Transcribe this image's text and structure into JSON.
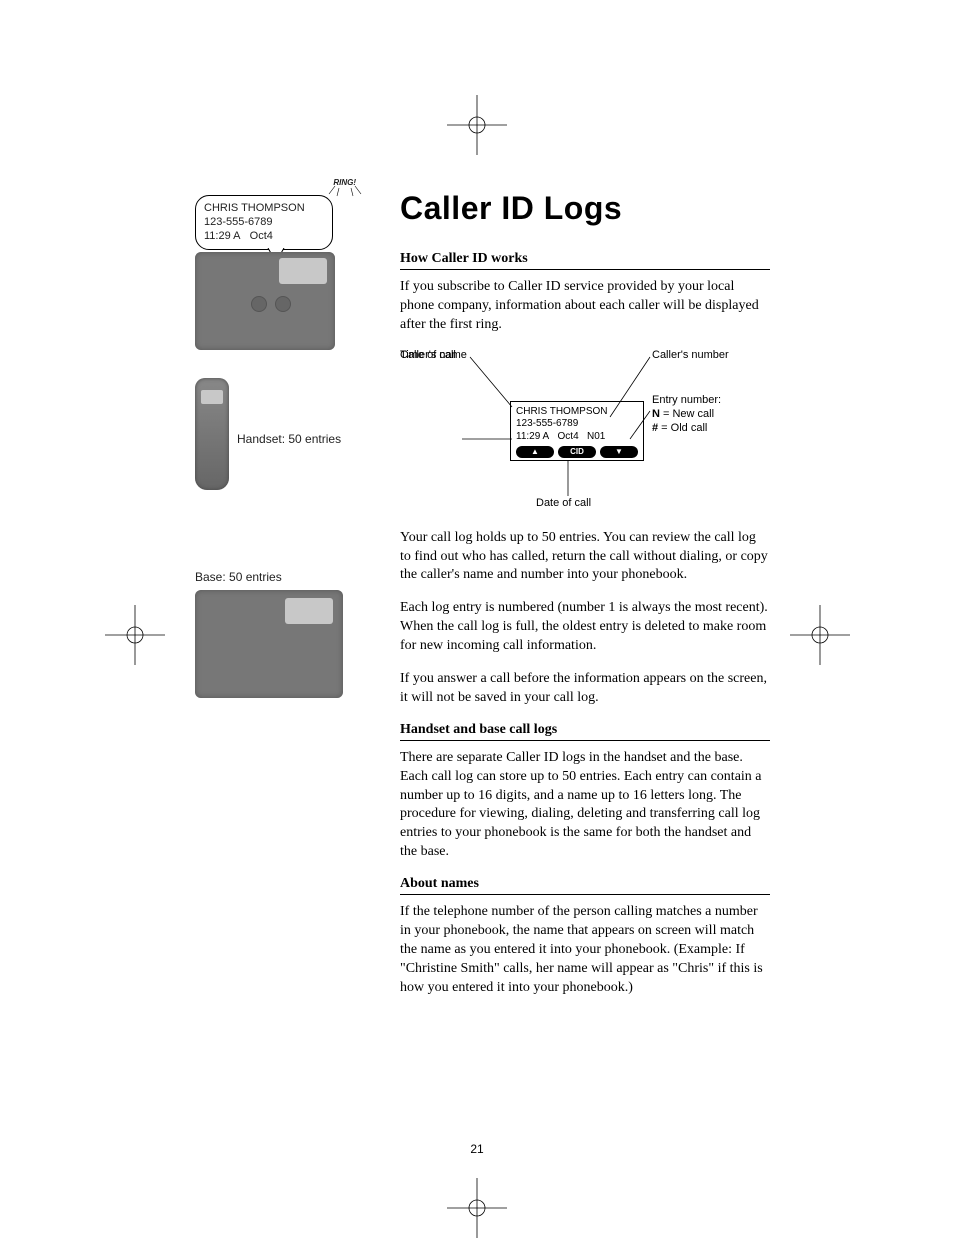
{
  "page_title": "Caller ID Logs",
  "page_number": "21",
  "sidebar": {
    "ring_label": "RING!",
    "callout": {
      "name": "CHRIS THOMPSON",
      "number": "123-555-6789",
      "time": "11:29 A",
      "date": "Oct4"
    },
    "handset_label": "Handset: 50 entries",
    "base_label": "Base: 50 entries"
  },
  "sections": {
    "s1_heading": "How Caller ID works",
    "s1_body": "If you subscribe to Caller ID service provided by your local phone company, information about each caller will be displayed after the first ring.",
    "s2_body1": "Your call log holds up to 50 entries. You can review the call log to find out who has called, return the call without dialing, or copy the caller's name and number into your phonebook.",
    "s2_body2": "Each log entry is numbered (number 1 is always the most recent). When the call log is full, the oldest entry is deleted to make room for new incoming call information.",
    "s2_body3": "If you answer a call before the information appears on the screen, it will not be saved in your call log.",
    "s3_heading": "Handset and base call logs",
    "s3_body": "There are separate Caller ID logs in the handset and the base. Each call log can store up to 50 entries. Each entry can contain a number up to 16 digits, and a name up to 16 letters long. The procedure for viewing, dialing, deleting and transferring call log entries to your phonebook is the same for both the handset and the base.",
    "s4_heading": "About names",
    "s4_body": "If the telephone number of the person calling matches a number in your phonebook, the name that appears on screen will match the name as you entered it into your phonebook. (Example: If \"Christine Smith\" calls, her name will appear as \"Chris\" if this is how you entered it into your phonebook.)"
  },
  "diagram": {
    "label_name": "Caller's name",
    "label_number": "Caller's number",
    "label_time": "Time of call",
    "label_date": "Date of call",
    "label_entry_title": "Entry number:",
    "label_entry_new_code": "N",
    "label_entry_new_desc": " = New call",
    "label_entry_old_code": "#",
    "label_entry_old_desc": " = Old call",
    "lcd": {
      "name": "CHRIS THOMPSON",
      "number": "123-555-6789",
      "time": "11:29 A",
      "date": "Oct4",
      "entry": "N01",
      "soft_left": "▲",
      "soft_mid": "CID",
      "soft_right": "▼"
    }
  }
}
